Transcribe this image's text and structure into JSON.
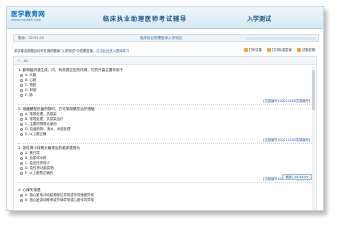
{
  "header": {
    "logo_name": "医学教育网",
    "logo_url": "www.med66.com",
    "title": "临床执业助理医师考试辅导",
    "right_title": "入学测试"
  },
  "infobar": {
    "time": "剩余：02:52:25",
    "paper": "临床执业助理医师入学测试"
  },
  "notice": {
    "text": "本试卷全部题目均可在我的题库\"入学测试\"中查看答案，",
    "link": "点击此处进入题库练习"
  },
  "tools": [
    "打印试卷",
    "打印标准答案",
    "试卷说明"
  ],
  "panel_head": "一、A1",
  "questions": [
    {
      "stem": "1. 影响组织液生成，内、有效滤过压的作用，它的升高主要作用于",
      "options": [
        "A. 大脑",
        "B. 心脏",
        "C. 肾脏",
        "D. 肝脏",
        "E. 肺"
      ],
      "ref": "【试题编号100011XXX答疑编号】"
    },
    {
      "stem": "2. 用缓解型抗菌药物时，它可采用哪些治疗措施",
      "options": [
        "A. 常规处理，抗感染",
        "B. 常规处理，抗感染治疗",
        "C. 主要药物联合使用",
        "D. 抗菌药物，消炎，对症处理",
        "E. 以上都正确"
      ],
      "ref": "【试题编号100011XXX答疑编号】"
    },
    {
      "stem": "3. 急性肾小球肾炎最常见的临床表现为",
      "options": [
        "A. 蛋白尿",
        "B. 血尿伴水肿",
        "C. 高血压伴尿少",
        "D. 急性肾功能衰竭",
        "E. 以上都是正确的"
      ],
      "ref": "【试题编号100011XXX答疑编号】"
    },
    {
      "stem": "4. 心律失常是",
      "options": [
        "A. 指心脏电冲动起源部位异常或传导速度异常",
        "B. 指心脏激动频率或节律异常或心脏传导异常"
      ],
      "ref": ""
    }
  ],
  "timer_button": "剩余：02:52:25"
}
